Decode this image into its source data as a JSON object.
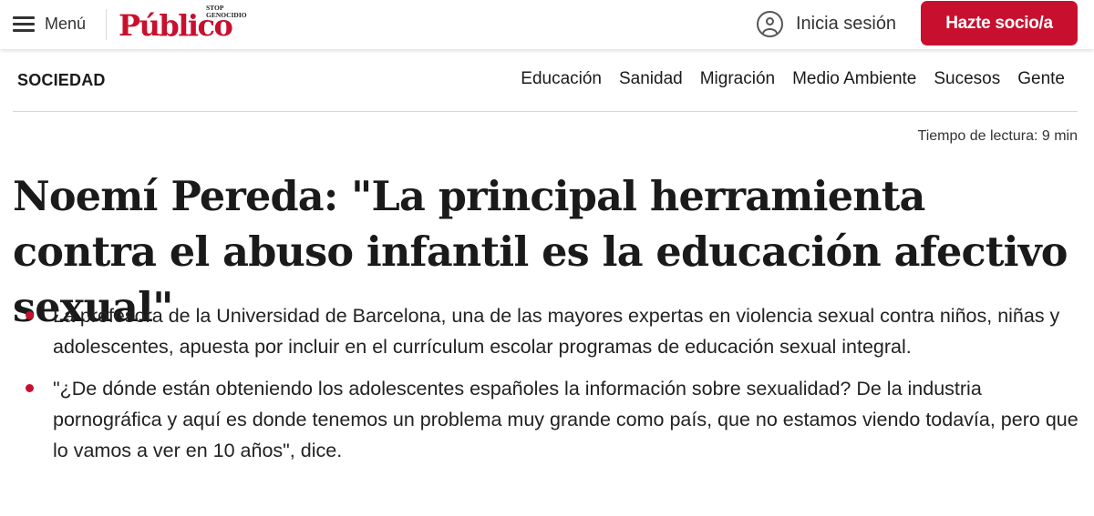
{
  "header": {
    "menu_label": "Menú",
    "logo": {
      "word": "Público",
      "tagline_line1": "STOP",
      "tagline_line2": "GENOCIDIO"
    },
    "login_label": "Inicia sesión",
    "cta_label": "Hazte socio/a"
  },
  "section": {
    "title": "SOCIEDAD",
    "nav": [
      "Educación",
      "Sanidad",
      "Migración",
      "Medio Ambiente",
      "Sucesos",
      "Gente"
    ]
  },
  "article": {
    "reading_time": "Tiempo de lectura: 9 min",
    "headline": "Noemí Pereda: \"La principal herramienta contra el abuso infantil es la educación afectivo sexual\"",
    "bullets": [
      "La profesora de la Universidad de Barcelona, una de las mayores expertas en violencia sexual contra niños, niñas y adolescentes, apuesta por incluir en el currículum escolar programas de educación sexual integral.",
      "\"¿De dónde están obteniendo los adolescentes españoles la información sobre sexualidad? De la industria pornográfica y aquí es donde tenemos un problema muy grande como país, que no estamos viendo todavía, pero que lo vamos a ver en 10 años\", dice."
    ]
  },
  "colors": {
    "brand": "#c8102e",
    "text": "#1a1a1a"
  },
  "icons": {
    "menu": "hamburger-icon",
    "login": "user-icon",
    "bullet": "bullet-dot-icon"
  }
}
